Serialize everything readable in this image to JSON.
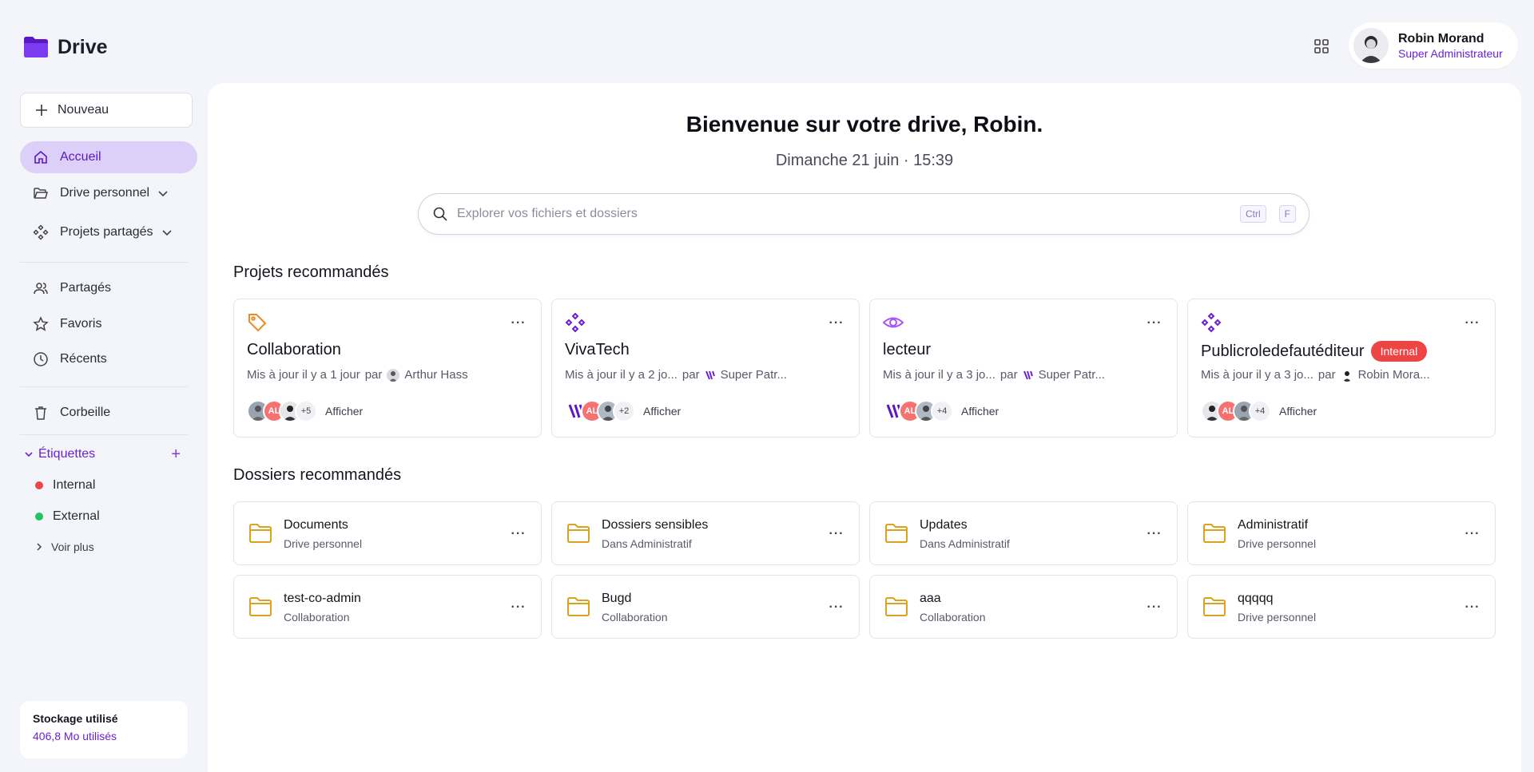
{
  "app": {
    "name": "Drive"
  },
  "user": {
    "name": "Robin Morand",
    "role": "Super Administrateur"
  },
  "sidebar": {
    "new_label": "Nouveau",
    "nav": [
      {
        "label": "Accueil",
        "icon": "home-icon",
        "active": true
      },
      {
        "label": "Drive personnel",
        "icon": "folder-open-icon"
      },
      {
        "label": "Projets partagés",
        "icon": "diamond-grid-icon"
      },
      {
        "label": "Partagés",
        "icon": "users-icon"
      },
      {
        "label": "Favoris",
        "icon": "star-icon"
      },
      {
        "label": "Récents",
        "icon": "clock-icon"
      },
      {
        "label": "Corbeille",
        "icon": "trash-icon"
      }
    ],
    "tags_title": "Étiquettes",
    "tags": [
      {
        "label": "Internal",
        "color": "#ef4444"
      },
      {
        "label": "External",
        "color": "#22c55e"
      }
    ],
    "see_more": "Voir plus",
    "storage_title": "Stockage utilisé",
    "storage_value": "406,8 Mo utilisés"
  },
  "main": {
    "welcome": "Bienvenue sur votre drive, Robin.",
    "date": "Dimanche 21 juin · 15:39",
    "search_placeholder": "Explorer vos fichiers et dossiers",
    "shortcut_keys": [
      "Ctrl",
      "F"
    ],
    "projects_title": "Projets recommandés",
    "projects": [
      {
        "name": "Collaboration",
        "icon": "tag-icon",
        "updated": "Mis à jour il y a 1 jour",
        "by_label": "par",
        "author": "Arthur Hass",
        "extra_count": "+5",
        "view_label": "Afficher",
        "badge": ""
      },
      {
        "name": "VivaTech",
        "icon": "diamond-grid-icon",
        "updated": "Mis à jour il y a 2 jo...",
        "by_label": "par",
        "author": "Super Patr...",
        "extra_count": "+2",
        "view_label": "Afficher",
        "badge": ""
      },
      {
        "name": "lecteur",
        "icon": "eye-icon",
        "updated": "Mis à jour il y a 3 jo...",
        "by_label": "par",
        "author": "Super Patr...",
        "extra_count": "+4",
        "view_label": "Afficher",
        "badge": ""
      },
      {
        "name": "Publicroledefautéditeur",
        "icon": "diamond-grid-icon",
        "updated": "Mis à jour il y a 3 jo...",
        "by_label": "par",
        "author": "Robin Mora...",
        "extra_count": "+4",
        "view_label": "Afficher",
        "badge": "Internal"
      }
    ],
    "avatar_initials": "AL",
    "folders_title": "Dossiers recommandés",
    "folders": [
      {
        "name": "Documents",
        "location": "Drive personnel"
      },
      {
        "name": "Dossiers sensibles",
        "location": "Dans Administratif"
      },
      {
        "name": "Updates",
        "location": "Dans Administratif"
      },
      {
        "name": "Administratif",
        "location": "Drive personnel"
      },
      {
        "name": "test-co-admin",
        "location": "Collaboration"
      },
      {
        "name": "Bugd",
        "location": "Collaboration"
      },
      {
        "name": "aaa",
        "location": "Collaboration"
      },
      {
        "name": "qqqqq",
        "location": "Drive personnel"
      }
    ]
  },
  "colors": {
    "accent": "#6b21d8",
    "active_bg": "#dcd0f9",
    "folder": "#d9a21f",
    "tag_orange": "#f08a24",
    "badge_red": "#ef4444"
  }
}
